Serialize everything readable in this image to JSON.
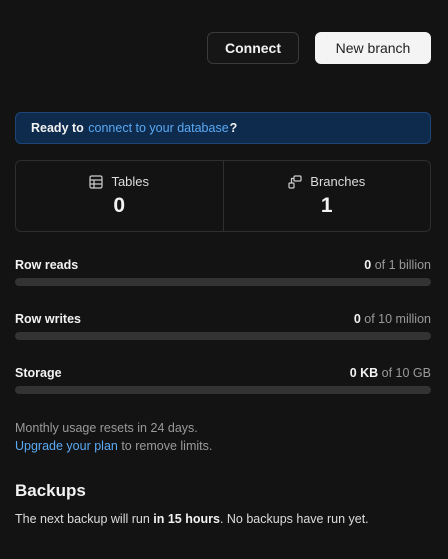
{
  "toolbar": {
    "connect_label": "Connect",
    "new_branch_label": "New branch"
  },
  "banner": {
    "prefix": "Ready to ",
    "link": "connect to your database",
    "suffix": "?"
  },
  "stats": {
    "tables": {
      "label": "Tables",
      "value": "0",
      "icon": "table-icon"
    },
    "branches": {
      "label": "Branches",
      "value": "1",
      "icon": "branch-icon"
    }
  },
  "usage": {
    "row_reads": {
      "label": "Row reads",
      "used": "0",
      "limit": " of 1 billion",
      "fraction": 0
    },
    "row_writes": {
      "label": "Row writes",
      "used": "0",
      "limit": " of 10 million",
      "fraction": 0
    },
    "storage": {
      "label": "Storage",
      "used": "0 KB",
      "limit": " of 10 GB",
      "fraction": 0
    }
  },
  "reset": {
    "line1": "Monthly usage resets in 24 days.",
    "upgrade_link": "Upgrade your plan",
    "line2_suffix": " to remove limits."
  },
  "backups": {
    "title": "Backups",
    "text_prefix": "The next backup will run ",
    "text_bold": "in 15 hours",
    "text_suffix": ". No backups have run yet."
  },
  "colors": {
    "background": "#131313",
    "accent": "#5aaaf5",
    "banner_bg": "#0e2a4c"
  }
}
